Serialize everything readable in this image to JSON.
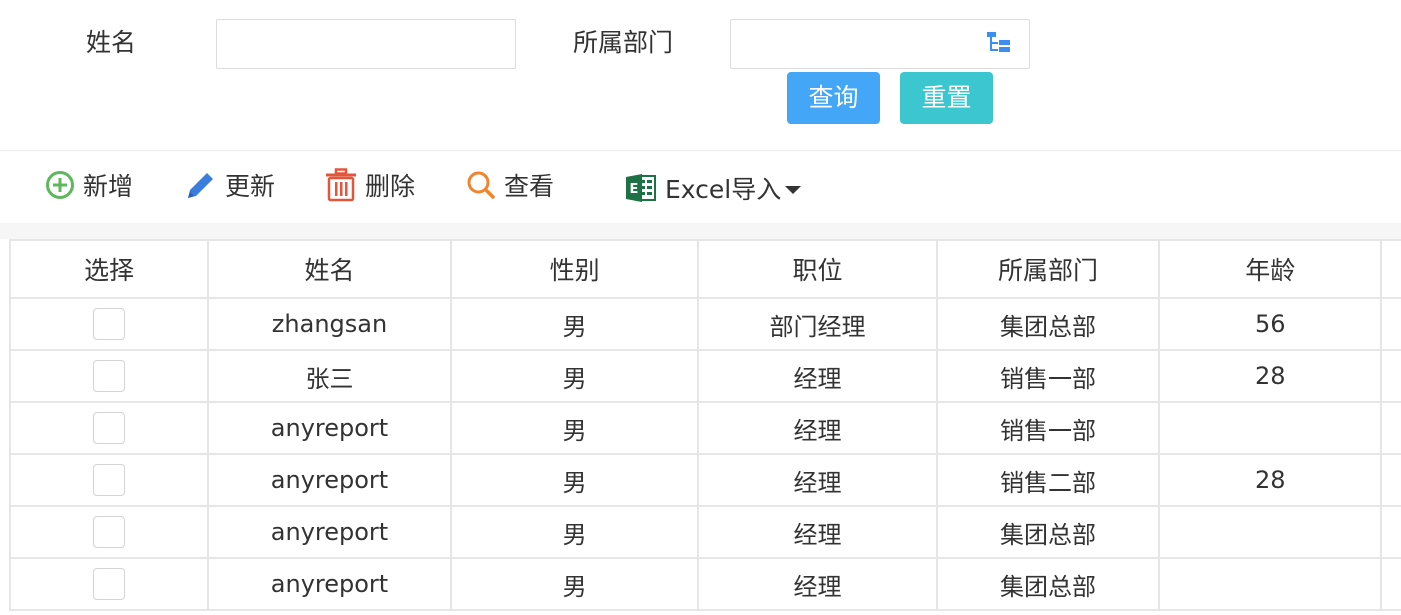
{
  "filter": {
    "name_label": "姓名",
    "name_value": "",
    "dept_label": "所属部门",
    "dept_value": "",
    "query_button": "查询",
    "reset_button": "重置"
  },
  "toolbar": {
    "add": "新增",
    "update": "更新",
    "delete": "删除",
    "view": "查看",
    "excel_import": "Excel导入"
  },
  "table": {
    "headers": [
      "选择",
      "姓名",
      "性别",
      "职位",
      "所属部门",
      "年龄"
    ],
    "rows": [
      {
        "name": "zhangsan",
        "gender": "男",
        "position": "部门经理",
        "dept": "集团总部",
        "age": "56"
      },
      {
        "name": "张三",
        "gender": "男",
        "position": "经理",
        "dept": "销售一部",
        "age": "28"
      },
      {
        "name": "anyreport",
        "gender": "男",
        "position": "经理",
        "dept": "销售一部",
        "age": ""
      },
      {
        "name": "anyreport",
        "gender": "男",
        "position": "经理",
        "dept": "销售二部",
        "age": "28"
      },
      {
        "name": "anyreport",
        "gender": "男",
        "position": "经理",
        "dept": "集团总部",
        "age": ""
      },
      {
        "name": "anyreport",
        "gender": "男",
        "position": "经理",
        "dept": "集团总部",
        "age": ""
      }
    ]
  },
  "colors": {
    "query": "#44a6f6",
    "reset": "#3cc6cf",
    "add_icon": "#5cb85c",
    "update_icon": "#3b7ddd",
    "delete_icon": "#e2573b",
    "view_icon": "#f0852d",
    "excel_icon": "#1e7145"
  }
}
